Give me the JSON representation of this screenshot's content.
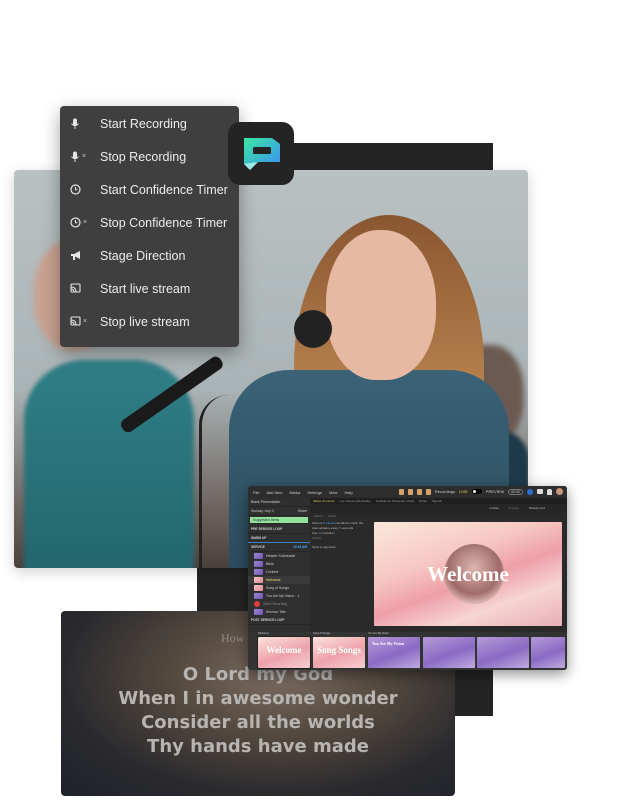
{
  "action_menu": {
    "items": [
      {
        "label": "Start Recording",
        "icon": "microphone-icon",
        "stop": false
      },
      {
        "label": "Stop Recording",
        "icon": "microphone-stop-icon",
        "stop": true
      },
      {
        "label": "Start Confidence Timer",
        "icon": "clock-icon",
        "stop": false
      },
      {
        "label": "Stop Confidence Timer",
        "icon": "clock-stop-icon",
        "stop": true
      },
      {
        "label": "Stage Direction",
        "icon": "megaphone-icon",
        "stop": false
      },
      {
        "label": "Start live stream",
        "icon": "livestream-icon",
        "stop": false
      },
      {
        "label": "Stop live stream",
        "icon": "livestream-stop-icon",
        "stop": true
      }
    ],
    "stop_mark": "×"
  },
  "logo": {
    "name": "app-logo",
    "colors": [
      "#3be8a0",
      "#3a8cf5"
    ]
  },
  "lyrics_output": {
    "song_title": "How Gr",
    "lines": [
      "O Lord my God",
      "When I in awesome wonder",
      "Consider all the worlds",
      "Thy hands have made"
    ]
  },
  "app": {
    "menubar": [
      "File",
      "Add Item",
      "Media",
      "Settings",
      "View",
      "Help"
    ],
    "header": {
      "recordings_label": "Recordings",
      "live_label": "LIVE",
      "preview_label": "PREVIEW",
      "timer": "00:00"
    },
    "sidebar": {
      "presentation_title": "Blank Presentation",
      "date": "Sunday, July 4",
      "share_label": "Share",
      "suggested_label": "Suggested Items",
      "sections": [
        {
          "label": "PRE SERVICE LOOP"
        },
        {
          "label": "WARM UP"
        },
        {
          "label": "SERVICE",
          "time": "10:15 AM"
        }
      ],
      "items": [
        {
          "label": "Header Subheader",
          "thumb": "purple"
        },
        {
          "label": "Bible",
          "thumb": "purple"
        },
        {
          "label": "Content",
          "thumb": "purple"
        },
        {
          "label": "Welcome",
          "thumb": "pink",
          "active": true
        },
        {
          "label": "Song of Songs",
          "thumb": "pink"
        },
        {
          "label": "You Are My Vision - 1",
          "thumb": "purple"
        },
        {
          "label": "Start Recording",
          "thumb": "record"
        },
        {
          "label": "Sermon Title",
          "thumb": "purple"
        }
      ],
      "post_section": "POST SERVICE LOOP"
    },
    "tabs": [
      "Slides (Content)",
      "Live Stream (Duplicate)",
      "Confidence (Presenter View)",
      "Notes",
      "Signals"
    ],
    "toolbar": {
      "guides_label": "Guides",
      "arrange_label": "Arrange",
      "background_label": "Background"
    },
    "subtool": [
      "Effects",
      "Styles"
    ],
    "props": {
      "line1_pre": "Show a",
      "line1_hl": "5 minute",
      "line1_post": "countdown clock, the",
      "line2_pre": "Auto advance every",
      "line2_hl": "5",
      "line2_post": "seconds",
      "line3_pre": "Use",
      "line3_hl": "no",
      "line3_post": "transition",
      "line4": "Shuffle",
      "send_label": "Send to sign feed"
    },
    "preview_title": "Welcome",
    "filmstrip": {
      "groups": [
        "Welcome",
        "Song of Songs",
        "You Are My Vision"
      ],
      "slides": [
        {
          "text": "Welcome",
          "style": "pink"
        },
        {
          "text": "Song Songs",
          "style": "pink"
        },
        {
          "text": "You Are My Vision",
          "style": "purple"
        },
        {
          "text": "",
          "style": "purple"
        },
        {
          "text": "",
          "style": "purple"
        },
        {
          "text": "",
          "style": "purple"
        }
      ]
    }
  }
}
